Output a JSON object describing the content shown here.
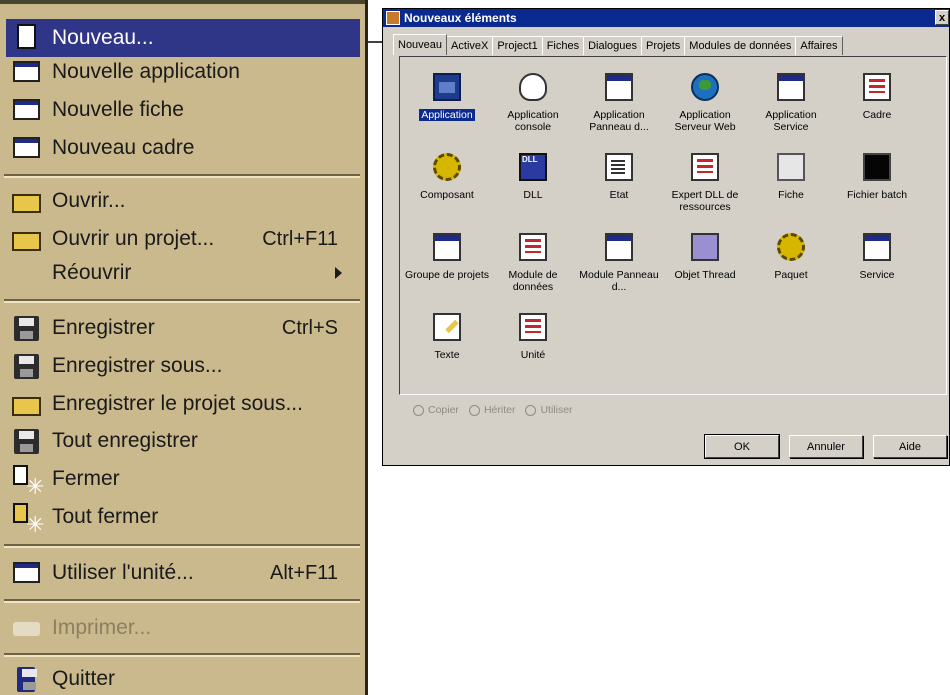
{
  "menu": {
    "items": [
      {
        "label": "Nouveau...",
        "shortcut": "",
        "icon": "new-document-icon",
        "state": "selected"
      },
      {
        "label": "Nouvelle application",
        "shortcut": "",
        "icon": "new-application-icon",
        "state": "normal"
      },
      {
        "label": "Nouvelle fiche",
        "shortcut": "",
        "icon": "new-form-icon",
        "state": "normal"
      },
      {
        "label": "Nouveau cadre",
        "shortcut": "",
        "icon": "new-frame-icon",
        "state": "normal"
      },
      {
        "label": "Ouvrir...",
        "shortcut": "",
        "icon": "open-folder-icon",
        "state": "normal"
      },
      {
        "label": "Ouvrir un projet...",
        "shortcut": "Ctrl+F11",
        "icon": "open-project-icon",
        "state": "normal"
      },
      {
        "label": "Réouvrir",
        "shortcut": "",
        "icon": "",
        "state": "submenu"
      },
      {
        "label": "Enregistrer",
        "shortcut": "Ctrl+S",
        "icon": "save-disk-icon",
        "state": "normal"
      },
      {
        "label": "Enregistrer sous...",
        "shortcut": "",
        "icon": "save-as-icon",
        "state": "normal"
      },
      {
        "label": "Enregistrer le projet sous...",
        "shortcut": "",
        "icon": "save-project-as-icon",
        "state": "normal"
      },
      {
        "label": "Tout enregistrer",
        "shortcut": "",
        "icon": "save-all-icon",
        "state": "normal"
      },
      {
        "label": "Fermer",
        "shortcut": "",
        "icon": "close-file-icon",
        "state": "normal"
      },
      {
        "label": "Tout fermer",
        "shortcut": "",
        "icon": "close-all-icon",
        "state": "normal"
      },
      {
        "label": "Utiliser l'unité...",
        "shortcut": "Alt+F11",
        "icon": "use-unit-icon",
        "state": "normal"
      },
      {
        "label": "Imprimer...",
        "shortcut": "",
        "icon": "printer-icon",
        "state": "disabled"
      },
      {
        "label": "Quitter",
        "shortcut": "",
        "icon": "quit-icon",
        "state": "normal"
      }
    ]
  },
  "dialog": {
    "title": "Nouveaux éléments",
    "close_label": "x",
    "tabs": [
      "Nouveau",
      "ActiveX",
      "Project1",
      "Fiches",
      "Dialogues",
      "Projets",
      "Modules de données",
      "Affaires"
    ],
    "active_tab": "Nouveau",
    "items": [
      {
        "label": "Application",
        "icon": "application-icon",
        "selected": true
      },
      {
        "label": "Application console",
        "icon": "console-app-icon",
        "selected": false
      },
      {
        "label": "Application Panneau d...",
        "icon": "control-panel-app-icon",
        "selected": false
      },
      {
        "label": "Application Serveur Web",
        "icon": "web-server-app-icon",
        "selected": false
      },
      {
        "label": "Application Service",
        "icon": "service-app-icon",
        "selected": false
      },
      {
        "label": "Cadre",
        "icon": "frame-icon",
        "selected": false
      },
      {
        "label": "Composant",
        "icon": "component-gear-icon",
        "selected": false
      },
      {
        "label": "DLL",
        "icon": "dll-icon",
        "selected": false
      },
      {
        "label": "Etat",
        "icon": "report-icon",
        "selected": false
      },
      {
        "label": "Expert DLL de ressources",
        "icon": "resource-dll-expert-icon",
        "selected": false
      },
      {
        "label": "Fiche",
        "icon": "form-icon",
        "selected": false
      },
      {
        "label": "Fichier batch",
        "icon": "batch-file-icon",
        "selected": false
      },
      {
        "label": "Groupe de projets",
        "icon": "project-group-icon",
        "selected": false
      },
      {
        "label": "Module de données",
        "icon": "data-module-icon",
        "selected": false
      },
      {
        "label": "Module Panneau d...",
        "icon": "control-panel-module-icon",
        "selected": false
      },
      {
        "label": "Objet Thread",
        "icon": "thread-object-icon",
        "selected": false
      },
      {
        "label": "Paquet",
        "icon": "package-icon",
        "selected": false
      },
      {
        "label": "Service",
        "icon": "service-icon",
        "selected": false
      },
      {
        "label": "Texte",
        "icon": "text-icon",
        "selected": false
      },
      {
        "label": "Unité",
        "icon": "unit-icon",
        "selected": false
      }
    ],
    "options": [
      "Copier",
      "Hériter",
      "Utiliser"
    ],
    "buttons": {
      "ok": "OK",
      "cancel": "Annuler",
      "help": "Aide"
    }
  },
  "colors": {
    "menu_bg": "#cbb98e",
    "highlight": "#2f3587",
    "dialog_bg": "#d4d0c8",
    "title_bar": "#0b2a8f"
  }
}
